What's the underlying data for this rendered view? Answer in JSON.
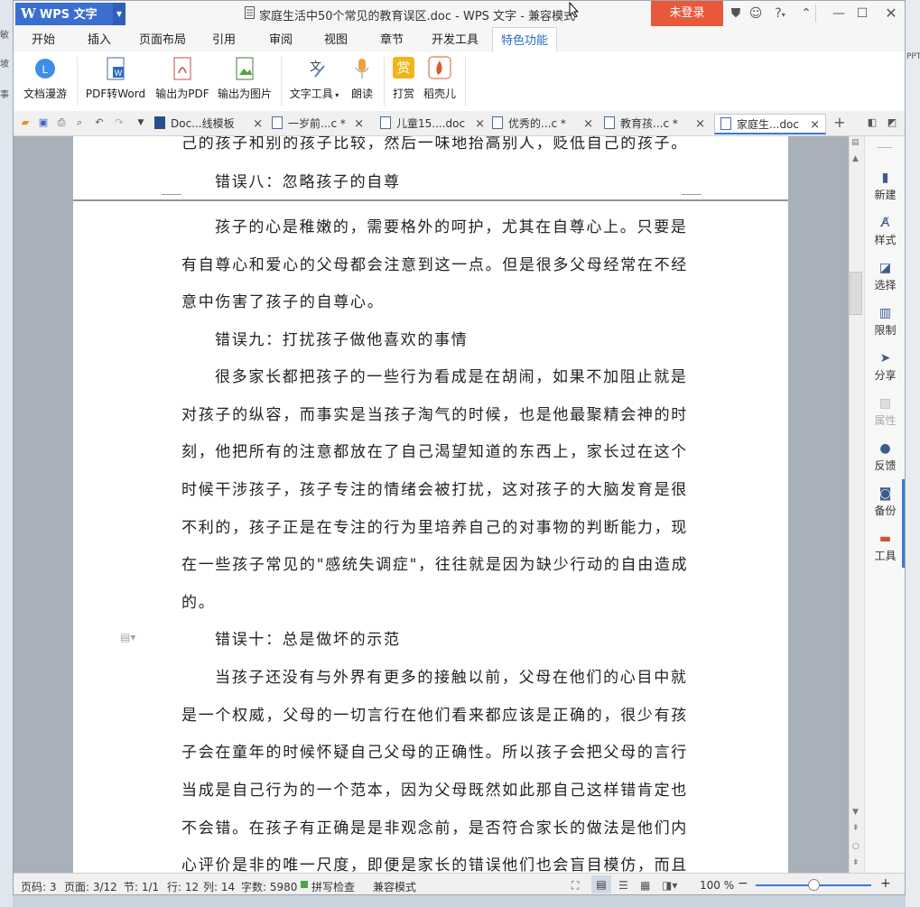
{
  "background": {
    "left_fragments": [
      "敏",
      "坡",
      "事"
    ],
    "right_fragments": [
      "PPT"
    ]
  },
  "titlebar": {
    "app_name": "WPS 文字",
    "title": "家庭生活中50个常见的教育误区.doc - WPS 文字 - 兼容模式",
    "login_label": "未登录",
    "help_label": "?"
  },
  "ribbon_tabs": [
    "开始",
    "插入",
    "页面布局",
    "引用",
    "审阅",
    "视图",
    "章节",
    "开发工具",
    "特色功能"
  ],
  "active_tab": "特色功能",
  "ribbon_buttons": [
    {
      "label": "文档漫游",
      "icon": "cloud-icon"
    },
    {
      "label": "PDF转Word",
      "icon": "pdf-to-word-icon"
    },
    {
      "label": "输出为PDF",
      "icon": "export-pdf-icon"
    },
    {
      "label": "输出为图片",
      "icon": "export-image-icon"
    },
    {
      "label": "文字工具",
      "icon": "text-tools-icon"
    },
    {
      "label": "朗读",
      "icon": "microphone-icon"
    },
    {
      "label": "打赏",
      "icon": "reward-icon",
      "glyph": "赏"
    },
    {
      "label": "稻壳儿",
      "icon": "docer-icon"
    }
  ],
  "doc_tabs": [
    {
      "label": "Doc...线模板"
    },
    {
      "label": "一岁前...c *"
    },
    {
      "label": "儿童15....doc"
    },
    {
      "label": "优秀的...c *"
    },
    {
      "label": "教育孩...c *"
    },
    {
      "label": "家庭生...doc"
    }
  ],
  "active_doc_tab": "家庭生...doc",
  "document": {
    "page1_lines": [
      "己的孩子和别的孩子比较，然后一味地抬高别人，贬低自己的孩子。",
      "错误八：忽略孩子的自尊"
    ],
    "page2_lines": [
      "孩子的心是稚嫩的，需要格外的呵护，尤其在自尊心上。只要是",
      "有自尊心和爱心的父母都会注意到这一点。但是很多父母经常在不经",
      "意中伤害了孩子的自尊心。",
      "错误九：打扰孩子做他喜欢的事情",
      "很多家长都把孩子的一些行为看成是在胡闹，如果不加阻止就是",
      "对孩子的纵容，而事实是当孩子淘气的时候，也是他最聚精会神的时",
      "刻，他把所有的注意都放在了自己渴望知道的东西上，家长过在这个",
      "时候干涉孩子，孩子专注的情绪会被打扰，这对孩子的大脑发育是很",
      "不利的，孩子正是在专注的行为里培养自己的对事物的判断能力，现",
      "在一些孩子常见的\"感统失调症\"，往往就是因为缺少行动的自由造成",
      "的。",
      "错误十：总是做坏的示范",
      "当孩子还没有与外界有更多的接触以前，父母在他们的心目中就",
      "是一个权威，父母的一切言行在他们看来都应该是正确的，很少有孩",
      "子会在童年的时候怀疑自己父母的正确性。所以孩子会把父母的言行",
      "当成是自己行为的一个范本，因为父母既然如此那自己这样错肯定也",
      "不会错。在孩子有正确是是非观念前，是否符合家长的做法是他们内",
      "心评价是非的唯一尺度，即便是家长的错误他们也会盲目模仿，而且"
    ]
  },
  "right_panel": [
    {
      "label": "新建",
      "icon": "new-doc-icon",
      "enabled": true
    },
    {
      "label": "样式",
      "icon": "style-icon",
      "enabled": true
    },
    {
      "label": "选择",
      "icon": "select-icon",
      "enabled": true
    },
    {
      "label": "限制",
      "icon": "restrict-icon",
      "enabled": true
    },
    {
      "label": "分享",
      "icon": "share-icon",
      "enabled": true
    },
    {
      "label": "属性",
      "icon": "properties-icon",
      "enabled": false
    },
    {
      "label": "反馈",
      "icon": "feedback-icon",
      "enabled": true
    },
    {
      "label": "备份",
      "icon": "backup-icon",
      "enabled": true
    },
    {
      "label": "工具",
      "icon": "toolbox-icon",
      "enabled": true
    }
  ],
  "statusbar": {
    "page_num": "页码: 3",
    "pages": "页面: 3/12",
    "section": "节: 1/1",
    "row": "行: 12",
    "col": "列: 14",
    "words": "字数: 5980",
    "spellcheck": "拼写检查",
    "compat": "兼容模式",
    "zoom": "100 %",
    "zoom_fraction": 0.5
  },
  "colors": {
    "brand_blue": "#3a6fd0",
    "login_red": "#e8593c",
    "accent_blue": "#3b78d6"
  }
}
